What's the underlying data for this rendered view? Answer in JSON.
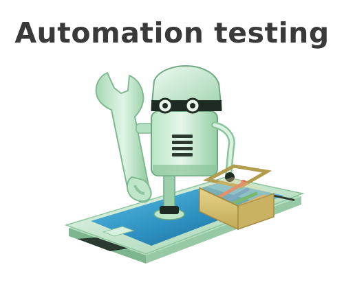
{
  "title": "Automation testing",
  "illustration": {
    "subject": "robot",
    "colors": {
      "mint": "#c9ecd3",
      "mint_mid": "#a9dbb8",
      "mint_dark": "#7fb98f",
      "screen": "#3aa3cf",
      "phone_body": "#dff3e4",
      "dark": "#1e2b22",
      "toolbox": "#d8c57a",
      "toolbox_dark": "#b29c4d",
      "tool_red": "#e06a55",
      "tool_orange": "#e8a04a",
      "tool_green": "#3ea85a",
      "tool_blue": "#4a8fd8"
    }
  }
}
